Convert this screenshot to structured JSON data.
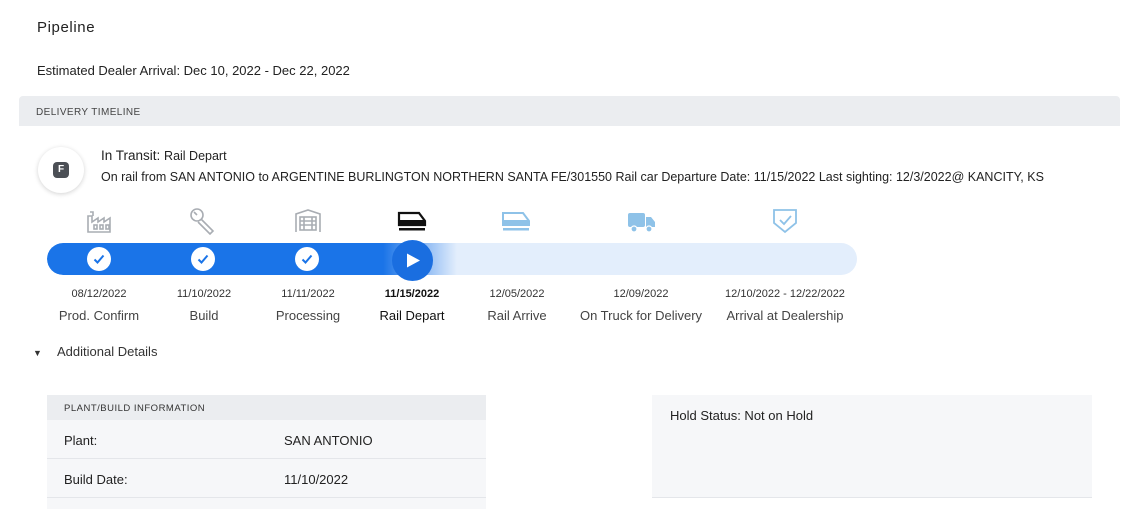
{
  "page": {
    "title": "Pipeline",
    "estimated_arrival": "Estimated Dealer Arrival: Dec 10, 2022 - Dec 22, 2022"
  },
  "timeline": {
    "header": "DELIVERY TIMELINE",
    "badge_letter": "F",
    "status_label": "In Transit:",
    "status_value": "Rail Depart",
    "detail": "On rail from SAN ANTONIO to ARGENTINE BURLINGTON NORTHERN SANTA FE/301550 Rail car Departure Date: 11/15/2022 Last sighting: 12/3/2022@ KANCITY, KS",
    "stages": [
      {
        "date": "08/12/2022",
        "label": "Prod. Confirm",
        "icon": "factory-icon",
        "state": "done"
      },
      {
        "date": "11/10/2022",
        "label": "Build",
        "icon": "wrench-icon",
        "state": "done"
      },
      {
        "date": "11/11/2022",
        "label": "Processing",
        "icon": "garage-icon",
        "state": "done"
      },
      {
        "date": "11/15/2022",
        "label": "Rail Depart",
        "icon": "train-icon",
        "state": "current"
      },
      {
        "date": "12/05/2022",
        "label": "Rail Arrive",
        "icon": "train-icon",
        "state": "pending"
      },
      {
        "date": "12/09/2022",
        "label": "On Truck for Delivery",
        "icon": "truck-icon",
        "state": "pending"
      },
      {
        "date": "12/10/2022 - 12/22/2022",
        "label": "Arrival at Dealership",
        "icon": "shield-check-icon",
        "state": "pending"
      }
    ],
    "colors": {
      "accent": "#1a74e8",
      "track_bg": "#e3eefc",
      "done_icon": "#a9adb3",
      "pending_icon": "#8ec2e8"
    }
  },
  "details": {
    "toggle_label": "Additional Details",
    "plant_header": "PLANT/BUILD INFORMATION",
    "plant_rows": [
      {
        "key": "Plant:",
        "value": "SAN ANTONIO"
      },
      {
        "key": "Build Date:",
        "value": "11/10/2022"
      }
    ],
    "hold_status": "Hold Status: Not on Hold"
  }
}
